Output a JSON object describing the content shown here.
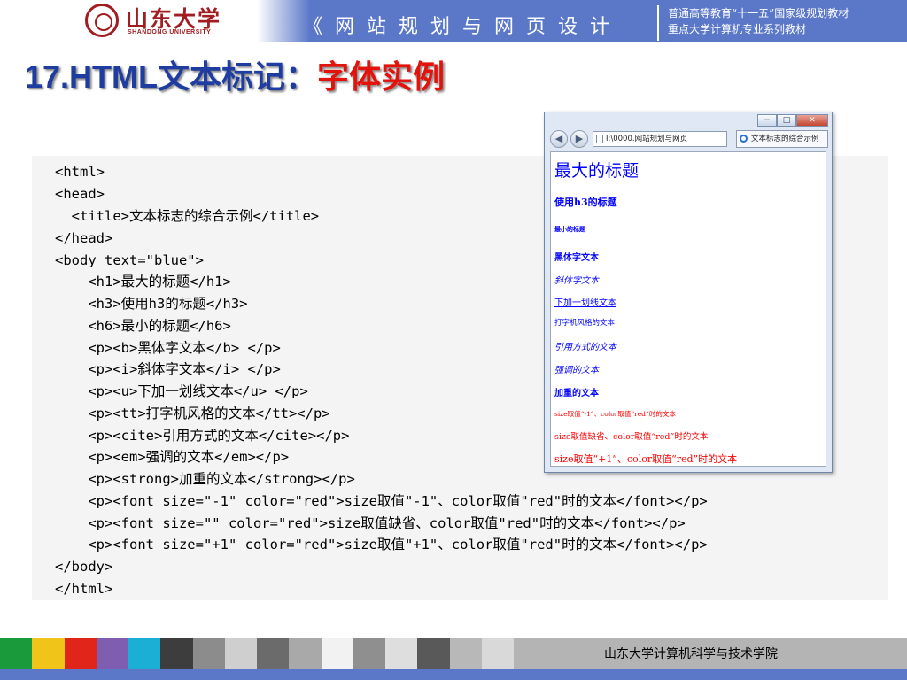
{
  "header": {
    "logo_cn": "山东大学",
    "logo_en": "SHANDONG UNIVERSITY",
    "course_title": "《网站规划与网页设计",
    "series_line1": "普通高等教育“十一五”国家级规划教材",
    "series_line2": "重点大学计算机专业系列教材",
    "accent_color": "#5b78c8"
  },
  "slide": {
    "title_main": "17.HTML文本标记：",
    "title_accent": "字体实例",
    "title_color": "#1f3da0",
    "accent_color": "#e3120b"
  },
  "code": {
    "lines": [
      "<html>",
      "<head>",
      "  <title>文本标志的综合示例</title>",
      "</head>",
      "<body text=\"blue\">",
      "    <h1>最大的标题</h1>",
      "    <h3>使用h3的标题</h3>",
      "    <h6>最小的标题</h6>",
      "    <p><b>黑体字文本</b> </p>",
      "    <p><i>斜体字文本</i> </p>",
      "    <p><u>下加一划线文本</u> </p>",
      "    <p><tt>打字机风格的文本</tt></p>",
      "    <p><cite>引用方式的文本</cite></p>",
      "    <p><em>强调的文本</em></p>",
      "    <p><strong>加重的文本</strong></p>",
      "    <p><font size=\"-1\" color=\"red\">size取值\"-1\"、color取值\"red\"时的文本</font></p>",
      "    <p><font size=\"\" color=\"red\">size取值缺省、color取值\"red\"时的文本</font></p>",
      "    <p><font size=\"+1\" color=\"red\">size取值\"+1\"、color取值\"red\"时的文本</font></p>",
      "</body>",
      "</html>"
    ]
  },
  "browser": {
    "window_buttons": [
      "−",
      "□",
      "✕"
    ],
    "address": "I:\\0000.网站规划与网页",
    "tab_title": "文本标志的综合示例",
    "back_icon": "back-arrow-icon",
    "forward_icon": "forward-arrow-icon",
    "content": {
      "h1": "最大的标题",
      "h3": "使用h3的标题",
      "h6": "最小的标题",
      "bold": "黑体字文本",
      "italic": "斜体字文本",
      "underline": "下加一划线文本",
      "tt": "打字机风格的文本",
      "cite": "引用方式的文本",
      "em": "强调的文本",
      "strong": "加重的文本",
      "font_minus1": "size取值“-1”、color取值“red”时的文本",
      "font_default": "size取值缺省、color取值“red”时的文本",
      "font_plus1": "size取值“+1”、color取值“red”时的文本"
    },
    "text_color": "#0000ff",
    "font_color": "#ff0000"
  },
  "footer": {
    "text": "山东大学计算机科学与技术学院",
    "strip_colors": [
      "#1a9a3a",
      "#f0c419",
      "#e0261b",
      "#7f5db0",
      "#1bafd6",
      "#3d3d3d",
      "#8c8c8c",
      "#cfcfcf",
      "#6b6b6b",
      "#a9a9a9",
      "#f2f2f2",
      "#8f8f8f",
      "#dedede",
      "#595959",
      "#b8b8b8",
      "#d9d9d9"
    ]
  }
}
